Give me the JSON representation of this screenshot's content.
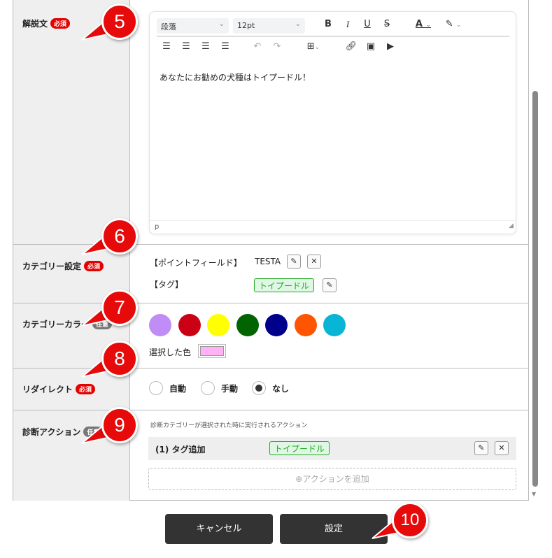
{
  "rows": {
    "description": {
      "label": "解説文",
      "badge": "必須",
      "editor": {
        "block_format": "段落",
        "font_size": "12pt",
        "content": "あなたにお勧めの犬種はトイプードル！",
        "status_path": "p",
        "toolbar": [
          "bold",
          "italic",
          "underline",
          "strikethrough",
          "font-color",
          "highlight",
          "align-left",
          "align-center",
          "align-right",
          "justify",
          "undo",
          "redo",
          "table",
          "link",
          "image",
          "media"
        ]
      }
    },
    "category": {
      "label": "カテゴリー設定",
      "badge": "必須",
      "point_field_label": "【ポイントフィールド】",
      "point_field_value": "TESTA",
      "tag_label": "【タグ】",
      "tag_value": "トイプードル"
    },
    "color": {
      "label": "カテゴリーカラー",
      "badge": "任意",
      "swatches": [
        "#c08cf5",
        "#cc0015",
        "#ffff00",
        "#006400",
        "#00008b",
        "#ff5500",
        "#09b5d4"
      ],
      "selected_label": "選択した色",
      "selected_color": "#ffb3f5"
    },
    "redirect": {
      "label": "リダイレクト",
      "badge": "必須",
      "options": [
        "自動",
        "手動",
        "なし"
      ],
      "selected": "なし"
    },
    "action": {
      "label": "診断アクション",
      "badge": "任意",
      "hint": "診断カテゴリーが選択された時に実行されるアクション",
      "items": [
        {
          "title": "(1) タグ追加",
          "tag": "トイプードル"
        }
      ],
      "add_label": "アクションを追加"
    }
  },
  "buttons": {
    "cancel": "キャンセル",
    "submit": "設定"
  },
  "callouts": [
    "5",
    "6",
    "7",
    "8",
    "9",
    "10"
  ],
  "colors": {
    "accent": "#e60a0a",
    "button": "#333333",
    "tag_green": "#22aa22"
  }
}
